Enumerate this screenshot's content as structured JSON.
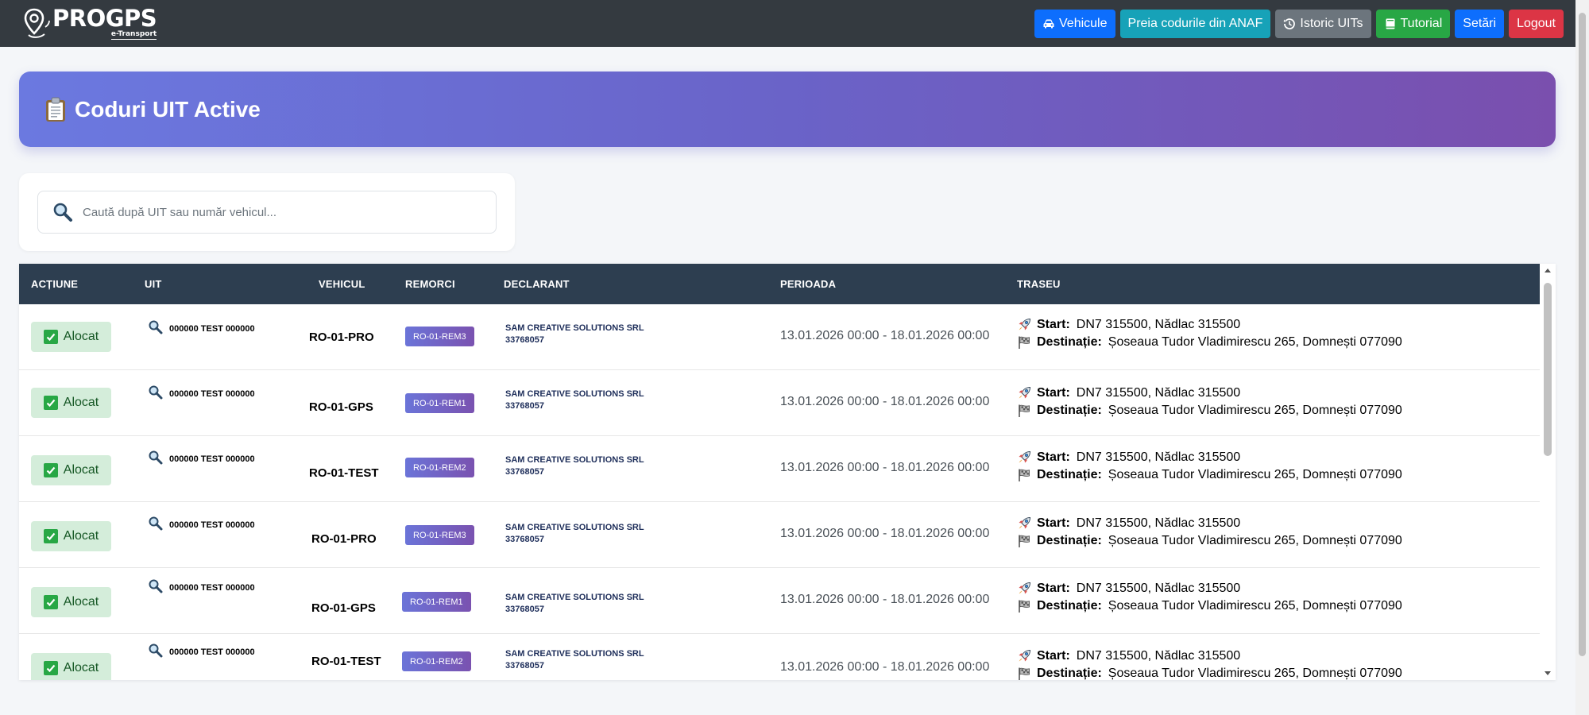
{
  "brand": {
    "name": "PROGPS",
    "subtitle": "e-Transport"
  },
  "nav": {
    "vehicles": "Vehicule",
    "fetch_anaf": "Preia codurile din ANAF",
    "history": "Istoric UITs",
    "tutorial": "Tutorial",
    "settings": "Setări",
    "logout": "Logout"
  },
  "colors": {
    "navbar": "#343a40",
    "primary": "#0d6efd",
    "info": "#17a2b8",
    "secondary": "#6c757d",
    "success": "#28a745",
    "danger": "#dc3545",
    "table_header": "#2d3e50"
  },
  "page": {
    "title": "Coduri UIT Active"
  },
  "search": {
    "placeholder": "Caută după UIT sau număr vehicul..."
  },
  "table": {
    "headers": {
      "action": "Acțiune",
      "uit": "UIT",
      "vehicle": "Vehicul",
      "trailers": "Remorci",
      "declarant": "Declarant",
      "period": "Perioada",
      "route": "Traseu"
    },
    "start_label": "Start:",
    "destination_label": "Destinație:",
    "rows": [
      {
        "action": "Alocat",
        "uit": "000000 TEST 000000",
        "vehicle": "RO-01-PRO",
        "trailer": "RO-01-REM3",
        "declarant_name": "SAM CREATIVE SOLUTIONS SRL",
        "declarant_code": "33768057",
        "period": "13.01.2026 00:00 - 18.01.2026 00:00",
        "start": "DN7 315500, Nădlac 315500",
        "destination": "Șoseaua Tudor Vladimirescu 265, Domnești 077090"
      },
      {
        "action": "Alocat",
        "uit": "000000 TEST 000000",
        "vehicle": "RO-01-GPS",
        "trailer": "RO-01-REM1",
        "declarant_name": "SAM CREATIVE SOLUTIONS SRL",
        "declarant_code": "33768057",
        "period": "13.01.2026 00:00 - 18.01.2026 00:00",
        "start": "DN7 315500, Nădlac 315500",
        "destination": "Șoseaua Tudor Vladimirescu 265, Domnești 077090"
      },
      {
        "action": "Alocat",
        "uit": "000000 TEST 000000",
        "vehicle": "RO-01-TEST",
        "trailer": "RO-01-REM2",
        "declarant_name": "SAM CREATIVE SOLUTIONS SRL",
        "declarant_code": "33768057",
        "period": "13.01.2026 00:00 - 18.01.2026 00:00",
        "start": "DN7 315500, Nădlac 315500",
        "destination": "Șoseaua Tudor Vladimirescu 265, Domnești 077090"
      },
      {
        "action": "Alocat",
        "uit": "000000 TEST 000000",
        "vehicle": "RO-01-PRO",
        "trailer": "RO-01-REM3",
        "declarant_name": "SAM CREATIVE SOLUTIONS SRL",
        "declarant_code": "33768057",
        "period": "13.01.2026 00:00 - 18.01.2026 00:00",
        "start": "DN7 315500, Nădlac 315500",
        "destination": "Șoseaua Tudor Vladimirescu 265, Domnești 077090"
      },
      {
        "action": "Alocat",
        "uit": "000000 TEST 000000",
        "vehicle": "RO-01-GPS",
        "trailer": "RO-01-REM1",
        "declarant_name": "SAM CREATIVE SOLUTIONS SRL",
        "declarant_code": "33768057",
        "period": "13.01.2026 00:00 - 18.01.2026 00:00",
        "start": "DN7 315500, Nădlac 315500",
        "destination": "Șoseaua Tudor Vladimirescu 265, Domnești 077090"
      },
      {
        "action": "Alocat",
        "uit": "000000 TEST 000000",
        "vehicle": "RO-01-TEST",
        "trailer": "RO-01-REM2",
        "declarant_name": "SAM CREATIVE SOLUTIONS SRL",
        "declarant_code": "33768057",
        "period": "13.01.2026 00:00 - 18.01.2026 00:00",
        "start": "DN7 315500, Nădlac 315500",
        "destination": "Șoseaua Tudor Vladimirescu 265, Domnești 077090"
      }
    ]
  }
}
